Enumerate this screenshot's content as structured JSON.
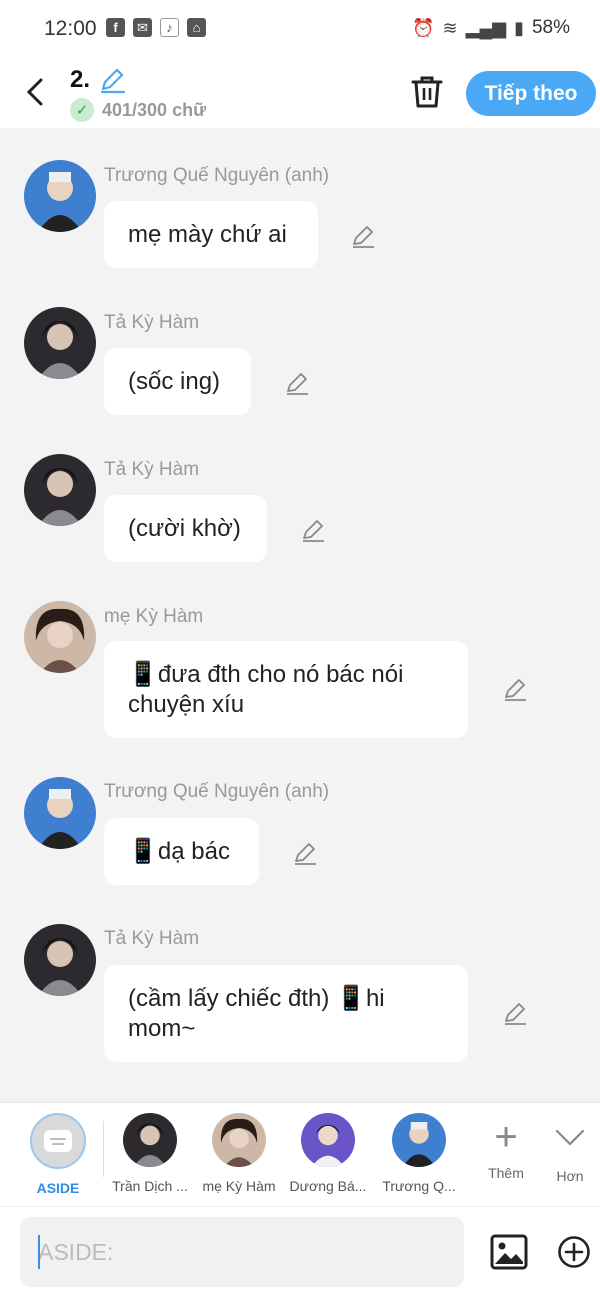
{
  "status_bar": {
    "time": "12:00",
    "left_icons": [
      "facebook-icon",
      "mail-icon",
      "tiktok-icon",
      "app-icon"
    ],
    "battery": "58%"
  },
  "header": {
    "title": "2.",
    "word_count": "401/300 chữ",
    "next_label": "Tiếp theo"
  },
  "messages": [
    {
      "sender": "Trương Quế Nguyên (anh)",
      "text": "mẹ mày chứ ai",
      "avatar": "blue"
    },
    {
      "sender": "Tả Kỳ Hàm",
      "text": "(sốc ing)",
      "avatar": "dark"
    },
    {
      "sender": "Tả Kỳ Hàm",
      "text": "(cười khờ)",
      "avatar": "dark"
    },
    {
      "sender": "mẹ Kỳ Hàm",
      "text": "📱đưa đth cho nó bác nói chuyện xíu",
      "avatar": "woman"
    },
    {
      "sender": "Trương Quế Nguyên (anh)",
      "text": "📱dạ bác",
      "avatar": "blue"
    },
    {
      "sender": "Tả Kỳ Hàm",
      "text": "(cầm lấy chiếc đth) 📱hi mom~",
      "avatar": "dark"
    }
  ],
  "character_bar": {
    "aside_label": "ASIDE",
    "characters": [
      {
        "name": "Trần Dịch ...",
        "avatar": "dark"
      },
      {
        "name": "mẹ Kỳ Hàm",
        "avatar": "woman"
      },
      {
        "name": "Dương Bá...",
        "avatar": "purple"
      },
      {
        "name": "Trương Q...",
        "avatar": "blue"
      }
    ],
    "add_label": "Thêm",
    "more_label": "Hơn"
  },
  "input": {
    "placeholder": "ASIDE:",
    "value": ""
  },
  "colors": {
    "accent": "#4aa8f4",
    "aside_active": "#2f8de4",
    "check_green": "#2fa34a"
  }
}
